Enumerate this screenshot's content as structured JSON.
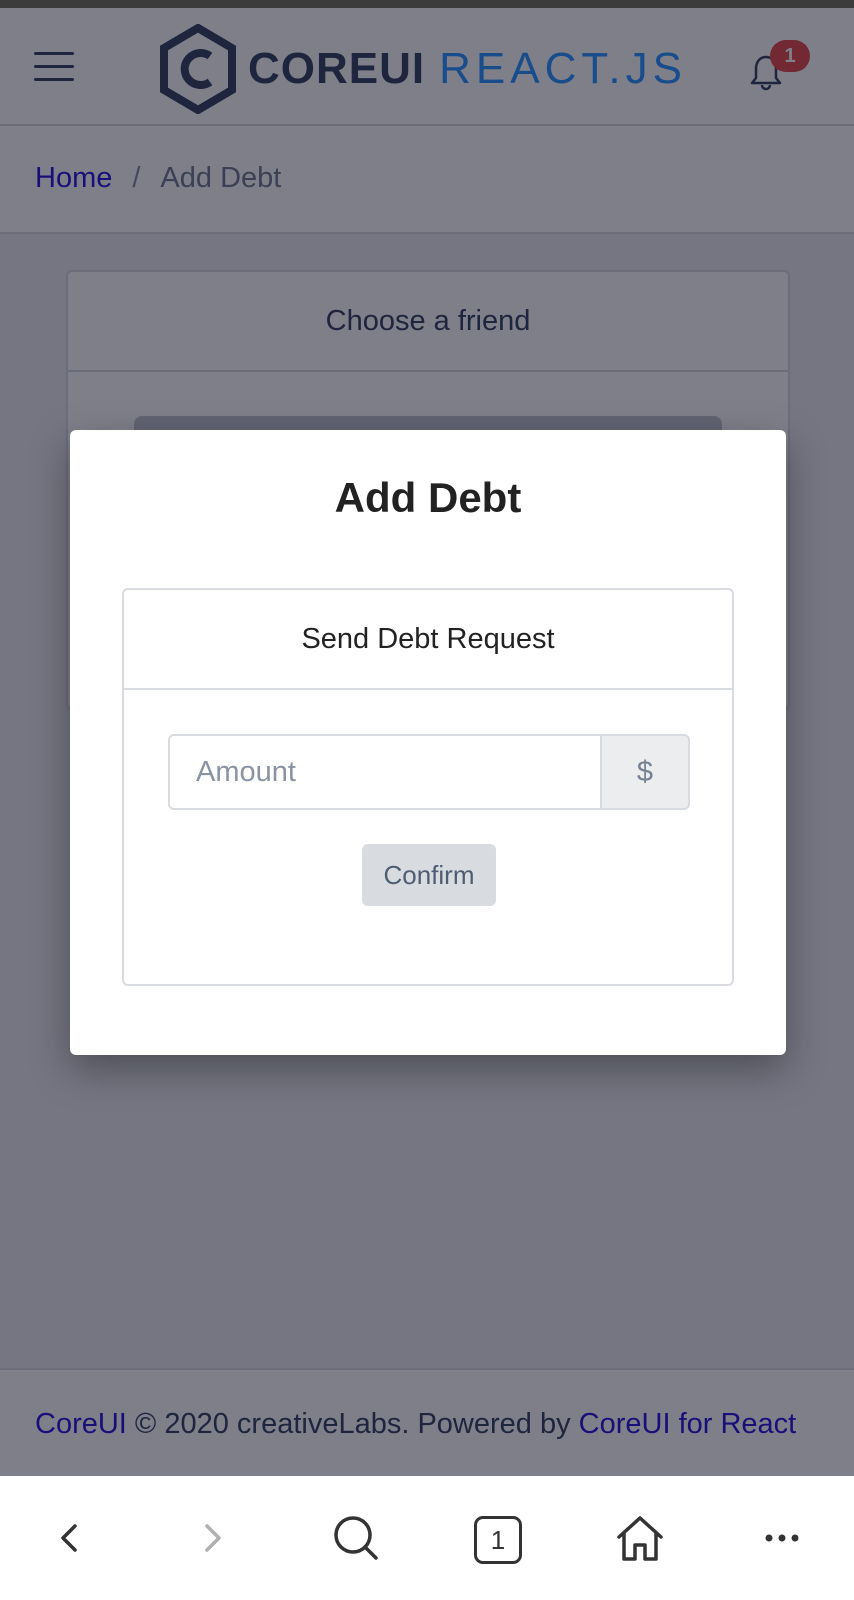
{
  "header": {
    "logo_brand": "COREUI",
    "logo_product": "REACT.JS",
    "notification_count": "1"
  },
  "breadcrumb": {
    "home": "Home",
    "separator": "/",
    "current": "Add Debt"
  },
  "background_card": {
    "title": "Choose a friend"
  },
  "modal": {
    "title": "Add Debt",
    "card_title": "Send Debt Request",
    "amount_placeholder": "Amount",
    "currency_symbol": "$",
    "confirm_label": "Confirm"
  },
  "footer": {
    "brand": "CoreUI",
    "copyright": " © 2020 creativeLabs. Powered by ",
    "powered_link": "CoreUI for React"
  },
  "browser": {
    "tab_count": "1"
  },
  "colors": {
    "brand_dark": "#3c4b64",
    "brand_blue": "#3399ff",
    "link": "#321fdb",
    "badge": "#e55353"
  },
  "icons": [
    "hamburger-icon",
    "coreui-logo-icon",
    "bell-icon",
    "back-icon",
    "forward-icon",
    "search-icon",
    "tabs-icon",
    "home-icon",
    "more-icon"
  ]
}
